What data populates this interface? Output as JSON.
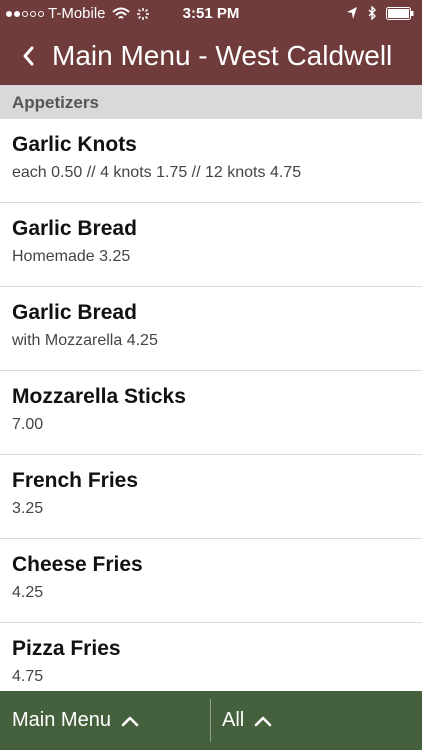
{
  "status_bar": {
    "carrier": "T-Mobile",
    "time": "3:51 PM",
    "signal_bars_filled": 2,
    "signal_bars_total": 5
  },
  "nav": {
    "title": "Main Menu - West Caldwell"
  },
  "section": {
    "title": "Appetizers"
  },
  "items": [
    {
      "name": "Garlic Knots",
      "desc": "each 0.50 // 4 knots 1.75 // 12 knots 4.75"
    },
    {
      "name": "Garlic Bread",
      "desc": "Homemade 3.25"
    },
    {
      "name": "Garlic Bread",
      "desc": "with Mozzarella 4.25"
    },
    {
      "name": "Mozzarella Sticks",
      "desc": "7.00"
    },
    {
      "name": "French Fries",
      "desc": "3.25"
    },
    {
      "name": "Cheese Fries",
      "desc": "4.25"
    },
    {
      "name": "Pizza Fries",
      "desc": "4.75"
    }
  ],
  "toolbar": {
    "menu_label": "Main Menu",
    "filter_label": "All"
  },
  "colors": {
    "nav_bg": "#6f3b3b",
    "toolbar_bg": "#45603d",
    "section_bg": "#d9d9d9"
  }
}
